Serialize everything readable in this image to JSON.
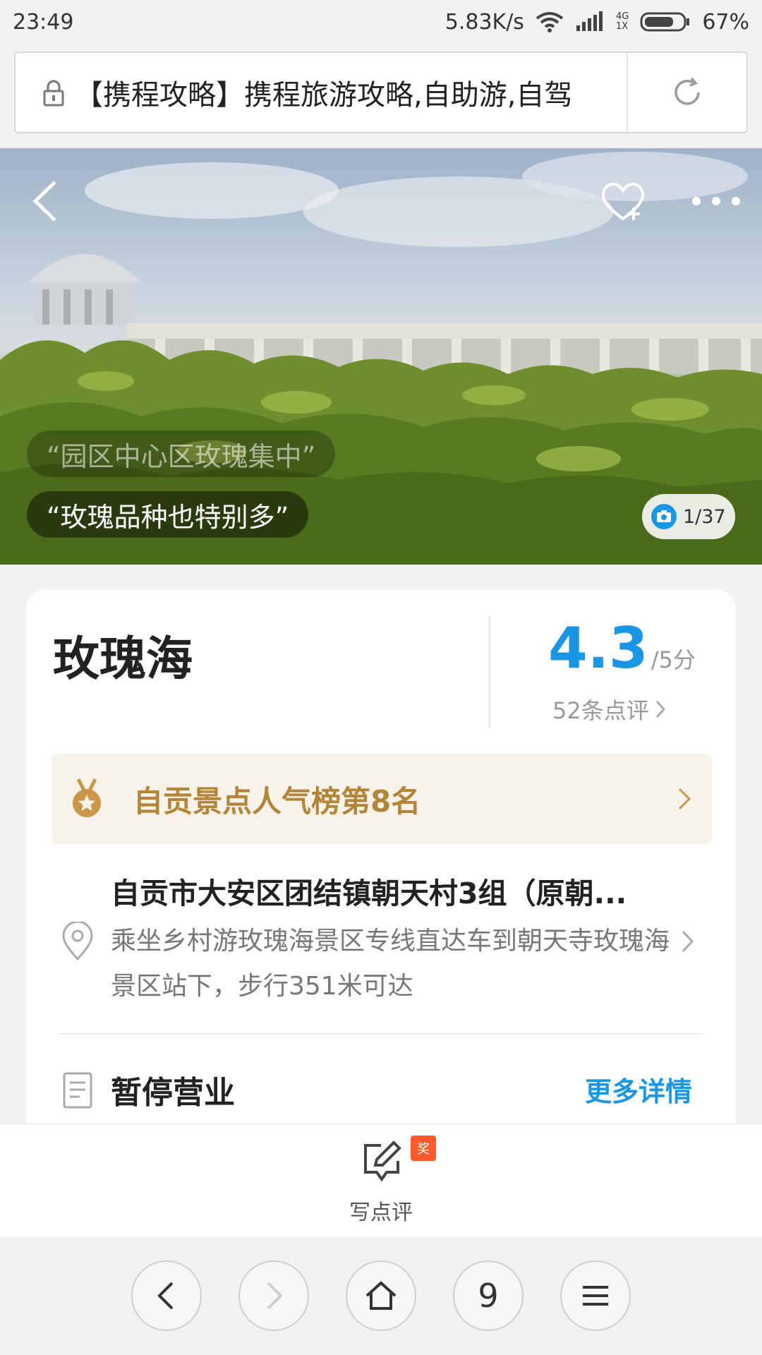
{
  "status_bar": {
    "time": "23:49",
    "speed": "5.83K/s",
    "net_top": "4G",
    "net_bottom": "1X",
    "battery": "67%"
  },
  "url_bar": {
    "text": "【携程攻略】携程旅游攻略,自助游,自驾"
  },
  "hero": {
    "quote1": "“园区中心区玫瑰集中”",
    "quote2": "“玫瑰品种也特别多”",
    "photo_counter": "1/37"
  },
  "card": {
    "title": "玫瑰海",
    "rating": "4.3",
    "rating_unit": "/5分",
    "reviews": "52条点评",
    "rank": "自贡景点人气榜第8名",
    "address_title": "自贡市大安区团结镇朝天村3组（原朝...",
    "address_desc": "乘坐乡村游玫瑰海景区专线直达车到朝天寺玫瑰海景区站下，步行351米可达",
    "status": "暂停营业",
    "more": "更多详情"
  },
  "review_bar": {
    "badge": "奖",
    "label": "写点评"
  },
  "nav": {
    "tabs_count": "9"
  },
  "colors": {
    "accent_blue": "#1996e6",
    "rank_gold": "#b38538",
    "badge_red": "#ff5a2b"
  }
}
